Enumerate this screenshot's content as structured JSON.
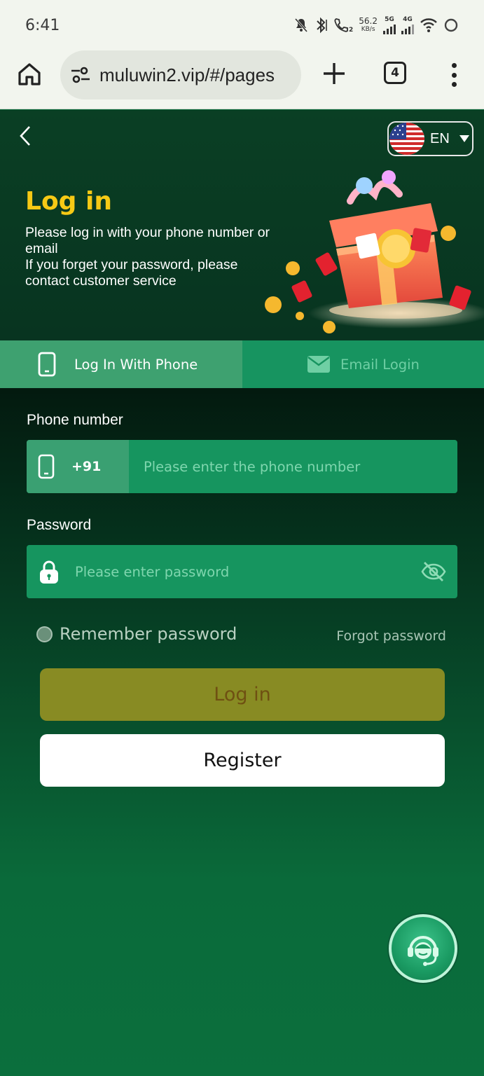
{
  "status_bar": {
    "time": "6:41",
    "net_speed_value": "56.2",
    "net_speed_unit": "KB/s",
    "network_1": "5G",
    "network_2": "4G",
    "call_sim": "2"
  },
  "browser": {
    "url": "muluwin2.vip/#/pages",
    "tab_count": "4"
  },
  "header": {
    "language": "EN"
  },
  "hero": {
    "title": "Log in",
    "line1": "Please log in with your phone number or email",
    "line2": "If you forget your password, please contact customer service"
  },
  "tabs": [
    {
      "label": "Log In With Phone",
      "icon": "phone-icon",
      "active": true
    },
    {
      "label": "Email Login",
      "icon": "mail-icon",
      "active": false
    }
  ],
  "form": {
    "phone_label": "Phone number",
    "country_code": "+91",
    "phone_placeholder": "Please enter the phone number",
    "password_label": "Password",
    "password_placeholder": "Please enter password",
    "remember_label": "Remember password",
    "forgot_label": "Forgot password",
    "login_button": "Log in",
    "register_button": "Register"
  },
  "colors": {
    "accent_yellow": "#f6c915",
    "tab_active": "#3ea170",
    "input_bg": "#16955f",
    "login_button_bg": "#888b23"
  }
}
